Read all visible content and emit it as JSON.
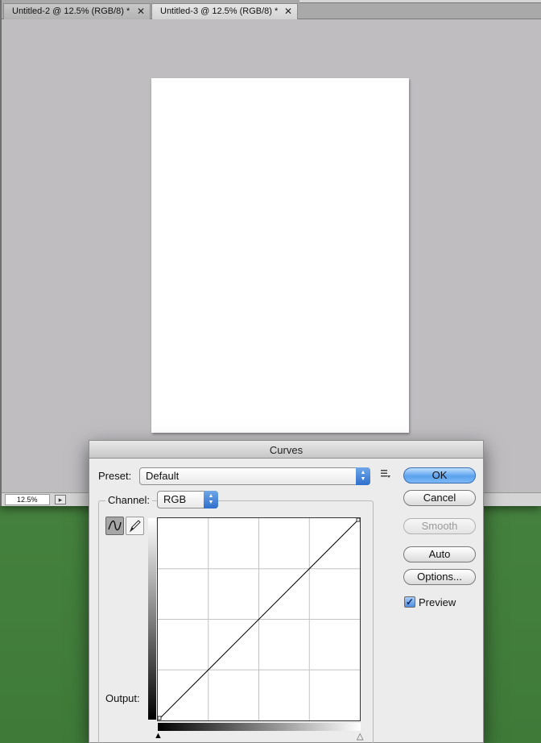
{
  "tabs": [
    {
      "label": "Untitled-2 @ 12.5% (RGB/8) *",
      "close": "✕"
    },
    {
      "label": "Untitled-3 @ 12.5% (RGB/8) *",
      "close": "✕"
    }
  ],
  "status": {
    "zoom": "12.5%"
  },
  "dialog": {
    "title": "Curves",
    "preset_label": "Preset:",
    "preset_value": "Default",
    "channel_label": "Channel:",
    "channel_value": "RGB",
    "output_label": "Output:",
    "buttons": {
      "ok": "OK",
      "cancel": "Cancel",
      "smooth": "Smooth",
      "auto": "Auto",
      "options": "Options..."
    },
    "preview_label": "Preview",
    "preview_checked": true
  },
  "colors": {
    "accent": "#4f8fe0",
    "desktop": "#4e8a45",
    "workspace": "#bfbdc0"
  },
  "icons": {
    "curve_tool": "curve-point-icon",
    "pencil_tool": "pencil-icon",
    "preset_menu": "preset-options-icon"
  }
}
